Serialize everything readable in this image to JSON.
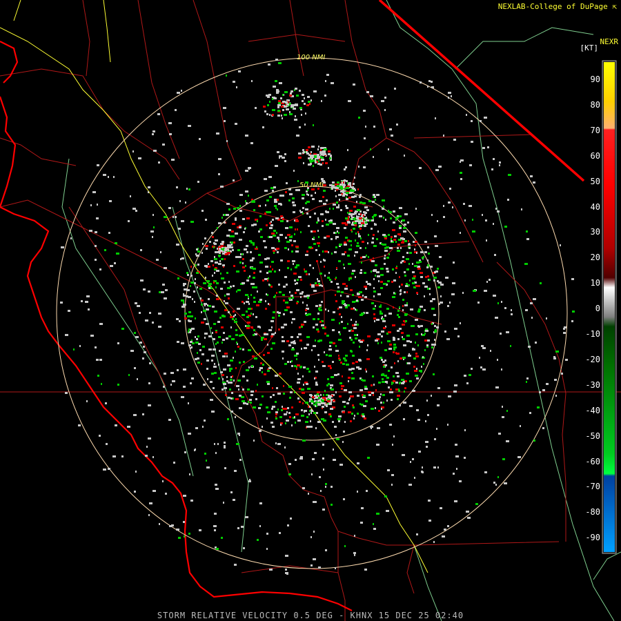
{
  "header": {
    "credit": "NEXLAB-College of DuPage",
    "credit_icon": "cursor-icon",
    "product": "NEXR",
    "units": "[KT]"
  },
  "rings": [
    {
      "label": "100 NMI"
    },
    {
      "label": "50 NMI"
    }
  ],
  "colorbar": {
    "ticks": [
      "90",
      "80",
      "70",
      "60",
      "50",
      "40",
      "30",
      "20",
      "10",
      "0",
      "-10",
      "-20",
      "-30",
      "-40",
      "-50",
      "-60",
      "-70",
      "-80",
      "-90"
    ]
  },
  "footer": {
    "caption": "STORM RELATIVE VELOCITY 0.5 DEG - KHNX 15 DEC 25 02:40"
  },
  "colors": {
    "coast": "#ff0000",
    "county": "#b01818",
    "highway": "#ffff33",
    "river": "#7fcf8f",
    "ring": "#ffdcb0",
    "inbound": "#00cc00",
    "outbound": "#dd0000",
    "nearzero": "#c8c8c8"
  }
}
